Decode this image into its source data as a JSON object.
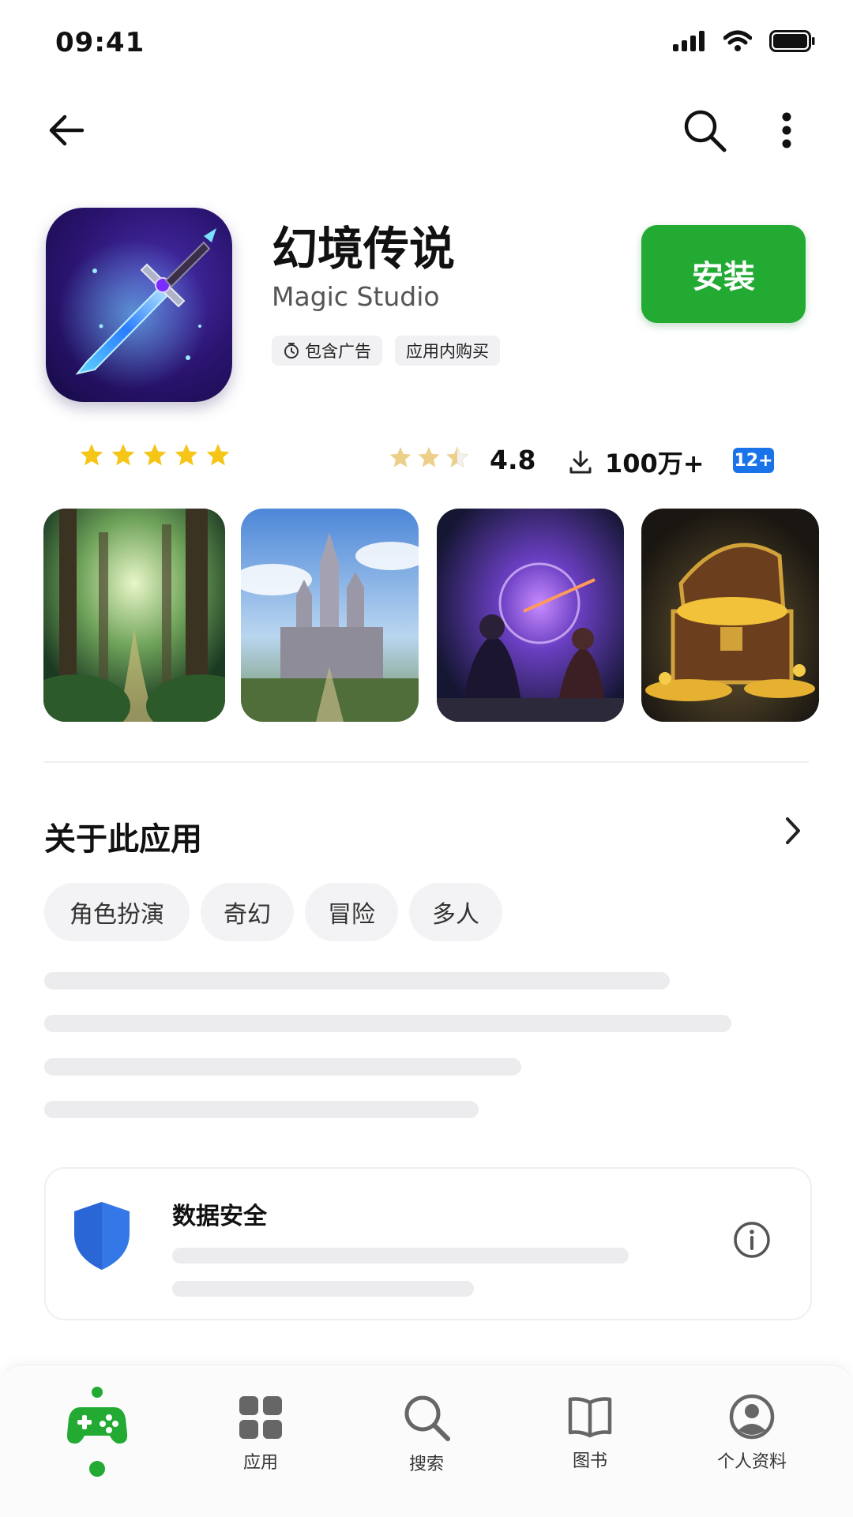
{
  "status_bar": {
    "time": "09:41"
  },
  "app": {
    "title": "幻境传说",
    "developer": "Magic Studio",
    "badges": [
      "包含广告",
      "应用内购买"
    ],
    "install_label": "安装",
    "rating": "4.8",
    "downloads": "100万+",
    "age_rating": "12+"
  },
  "about": {
    "title": "关于此应用",
    "tags": [
      "角色扮演",
      "奇幻",
      "冒险",
      "多人"
    ]
  },
  "data_safety": {
    "title": "数据安全"
  },
  "bottom_nav": {
    "items": [
      {
        "label": "",
        "icon": "gamepad-icon",
        "active": true
      },
      {
        "label": "应用",
        "icon": "apps-grid-icon"
      },
      {
        "label": "搜索",
        "icon": "search-icon"
      },
      {
        "label": "图书",
        "icon": "book-icon"
      },
      {
        "label": "个人资料",
        "icon": "profile-icon"
      }
    ]
  },
  "colors": {
    "accent_green": "#22aa33",
    "star_yellow": "#f5c518",
    "badge_blue": "#1a73e8",
    "shield_blue": "#3478e8"
  }
}
